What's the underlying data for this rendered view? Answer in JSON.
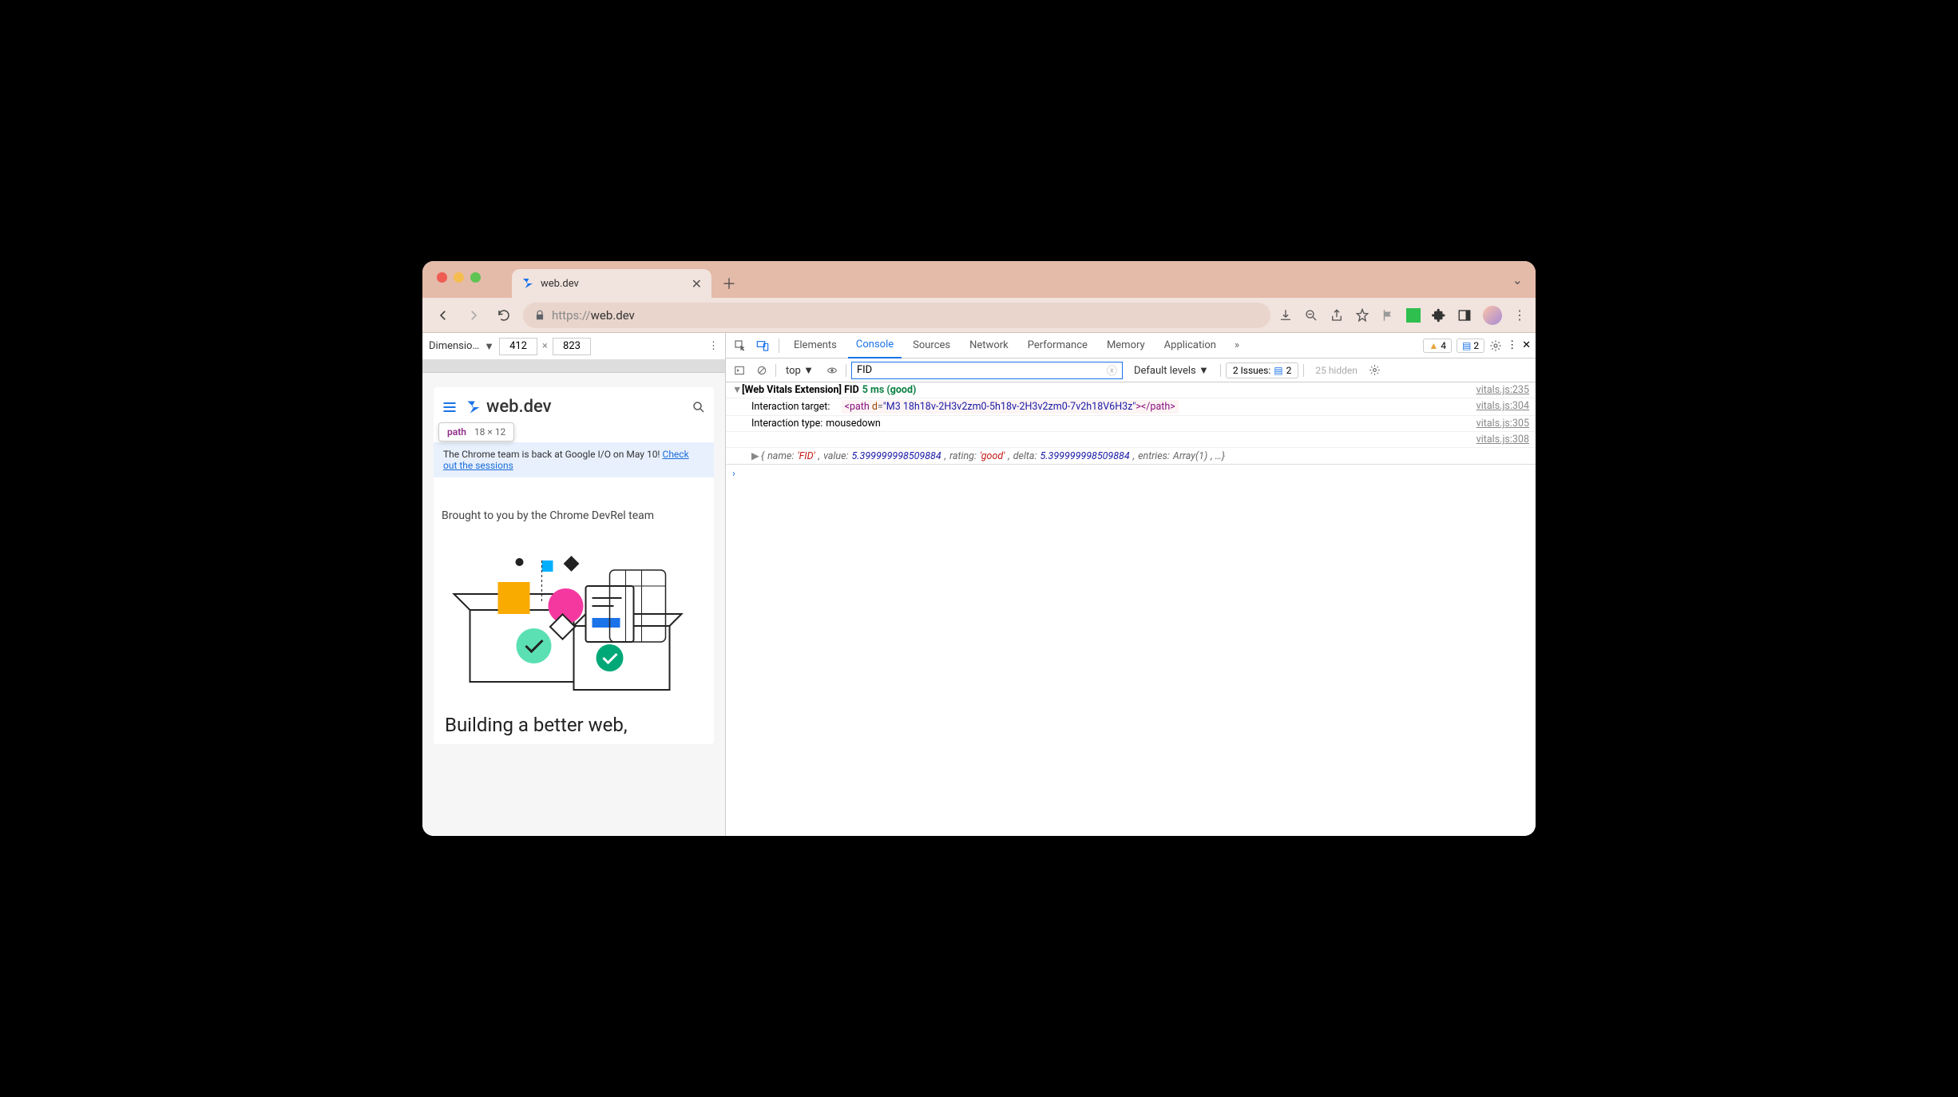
{
  "tab": {
    "title": "web.dev"
  },
  "url": {
    "protocol": "https://",
    "host": "web.dev"
  },
  "dimensions": {
    "label": "Dimensio…",
    "width": "412",
    "height": "823"
  },
  "tooltip": {
    "tag": "path",
    "size": "18 × 12"
  },
  "site": {
    "logo": "web.dev",
    "banner_text": "The Chrome team is back at Google I/O on May 10! ",
    "banner_link": "Check out the sessions",
    "brought": "Brought to you by the Chrome DevRel team",
    "headline": "Building a better web,"
  },
  "devtools_tabs": [
    "Elements",
    "Console",
    "Sources",
    "Network",
    "Performance",
    "Memory",
    "Application"
  ],
  "devtools_active": "Console",
  "badges": {
    "warnings": "4",
    "messages": "2"
  },
  "console_bar": {
    "context": "top",
    "filter": "FID",
    "levels": "Default levels",
    "issues_label": "2 Issues:",
    "issues_count": "2",
    "hidden": "25 hidden"
  },
  "log": {
    "header_prefix": "[Web Vitals Extension] FID",
    "header_value": "5 ms (good)",
    "srcs": [
      "vitals.js:235",
      "vitals.js:304",
      "vitals.js:305",
      "vitals.js:308"
    ],
    "line1_label": "Interaction target:",
    "line1_tag": "path",
    "line1_attr": "d",
    "line1_val": "\"M3 18h18v-2H3v2zm0-5h18v-2H3v2zm0-7v2h18V6H3z\"",
    "line2_label": "Interaction type:",
    "line2_val": "mousedown",
    "obj_name": "name:",
    "obj_name_v": "'FID'",
    "obj_value": "value:",
    "obj_value_v": "5.399999998509884",
    "obj_rating": "rating:",
    "obj_rating_v": "'good'",
    "obj_delta": "delta:",
    "obj_delta_v": "5.399999998509884",
    "obj_entries": "entries:",
    "obj_entries_v": "Array(1)",
    "obj_rest": ", …}"
  }
}
